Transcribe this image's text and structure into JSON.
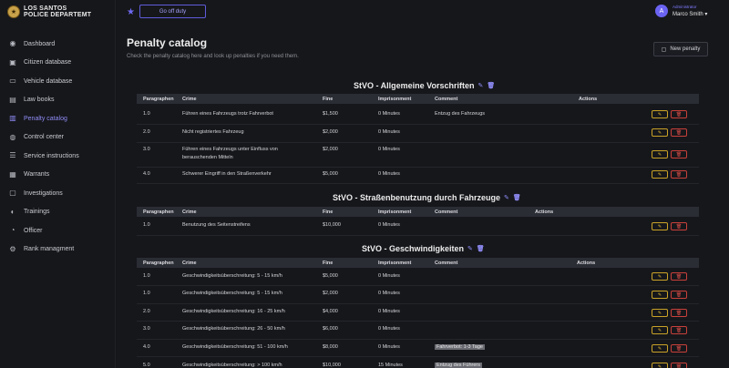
{
  "brand": {
    "line1": "LOS SANTOS",
    "line2": "POLICE DEPARTEMT"
  },
  "sidebar": {
    "items": [
      {
        "label": "Dashboard",
        "icon": "◉",
        "active": false
      },
      {
        "label": "Citizen database",
        "icon": "▣",
        "active": false
      },
      {
        "label": "Vehicle database",
        "icon": "▭",
        "active": false
      },
      {
        "label": "Law books",
        "icon": "▤",
        "active": false
      },
      {
        "label": "Penalty catalog",
        "icon": "▥",
        "active": true
      },
      {
        "label": "Control center",
        "icon": "◍",
        "active": false
      },
      {
        "label": "Service instructions",
        "icon": "☰",
        "active": false
      },
      {
        "label": "Warrants",
        "icon": "▦",
        "active": false
      },
      {
        "label": "Investigations",
        "icon": "▢",
        "active": false
      },
      {
        "label": "Trainings",
        "icon": "◐",
        "active": false
      },
      {
        "label": "Officer",
        "icon": "◔",
        "active": false
      },
      {
        "label": "Rank managment",
        "icon": "⚙",
        "active": false
      }
    ]
  },
  "topbar": {
    "go_off_duty": "Go off duty",
    "user_initial": "A",
    "user_role": "Administrator",
    "user_name": "Marco Smith"
  },
  "page": {
    "title": "Penalty catalog",
    "subtitle": "Check the penalty catalog here and look up penalties if you need them.",
    "new_penalty": "New penalty"
  },
  "columns": {
    "paragraphen": "Paragraphen",
    "crime": "Crime",
    "fine": "Fine",
    "imprisonment": "Imprisonment",
    "comment": "Comment",
    "actions": "Actions"
  },
  "sections": [
    {
      "title": "StVO - Allgemeine Vorschriften",
      "rows": [
        {
          "par": "1.0",
          "crime": "Führen eines Fahrzeugs trotz Fahrverbot",
          "fine": "$1,500",
          "imp": "0 Minutes",
          "comment": "Entzug des Fahrzeugs"
        },
        {
          "par": "2.0",
          "crime": "Nicht registriertes Fahrzeug",
          "fine": "$2,000",
          "imp": "0 Minutes",
          "comment": ""
        },
        {
          "par": "3.0",
          "crime": "Führen eines Fahrzeugs unter Einfluss von",
          "crime2": "berauschenden Mitteln",
          "fine": "$2,000",
          "imp": "0 Minutes",
          "comment": ""
        },
        {
          "par": "4.0",
          "crime": "Schwerer Eingriff in den Straßenverkehr",
          "fine": "$5,000",
          "imp": "0 Minutes",
          "comment": ""
        }
      ]
    },
    {
      "title": "StVO - Straßenbenutzung durch Fahrzeuge",
      "rows": [
        {
          "par": "1.0",
          "crime": "Benutzung des Seitenstreifens",
          "fine": "$10,000",
          "imp": "0 Minutes",
          "comment": ""
        }
      ]
    },
    {
      "title": "StVO - Geschwindigkeiten",
      "rows": [
        {
          "par": "1.0",
          "crime": "Geschwindigkeitsüberschreitung: 5 - 15 km/h",
          "fine": "$5,000",
          "imp": "0 Minutes",
          "comment": ""
        },
        {
          "par": "1.0",
          "crime": "Geschwindigkeitsüberschreitung: 5 - 15 km/h",
          "fine": "$2,000",
          "imp": "0 Minutes",
          "comment": ""
        },
        {
          "par": "2.0",
          "crime": "Geschwindigkeitsüberschreitung: 16 - 25 km/h",
          "fine": "$4,000",
          "imp": "0 Minutes",
          "comment": ""
        },
        {
          "par": "3.0",
          "crime": "Geschwindigkeitsüberschreitung: 26 - 50 km/h",
          "fine": "$6,000",
          "imp": "0 Minutes",
          "comment": ""
        },
        {
          "par": "4.0",
          "crime": "Geschwindigkeitsüberschreitung: 51 - 100 km/h",
          "fine": "$8,000",
          "imp": "0 Minutes",
          "comment": "Fahrverbot: 1-3 Tage"
        },
        {
          "par": "5.0",
          "crime": "Geschwindigkeitsüberschreitung: > 100 km/h",
          "fine": "$10,000",
          "imp": "15 Minutes",
          "comment": "Entzug des Führers"
        }
      ]
    }
  ],
  "icons": {
    "edit": "✎",
    "delete": "🗑",
    "star": "★"
  },
  "colors": {
    "accent": "#6f6af3",
    "edit": "#c9a227",
    "delete": "#c8403a"
  }
}
